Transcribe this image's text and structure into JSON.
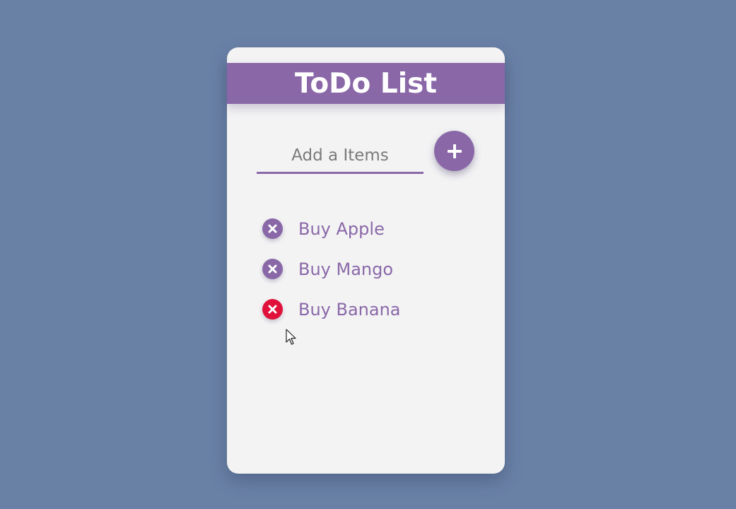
{
  "app": {
    "title": "ToDo List"
  },
  "input": {
    "placeholder": "Add a Items",
    "value": ""
  },
  "add_button": {
    "icon": "plus-icon"
  },
  "items": [
    {
      "label": "Buy Apple",
      "icon": "close-circle-icon",
      "state": "normal"
    },
    {
      "label": "Buy Mango",
      "icon": "close-circle-icon",
      "state": "normal"
    },
    {
      "label": "Buy Banana",
      "icon": "close-circle-icon",
      "state": "hover"
    }
  ],
  "colors": {
    "background": "#6a81a6",
    "card": "#f3f3f4",
    "accent": "#8a68a8",
    "delete_hover": "#e0113a",
    "text_on_accent": "#ffffff"
  }
}
